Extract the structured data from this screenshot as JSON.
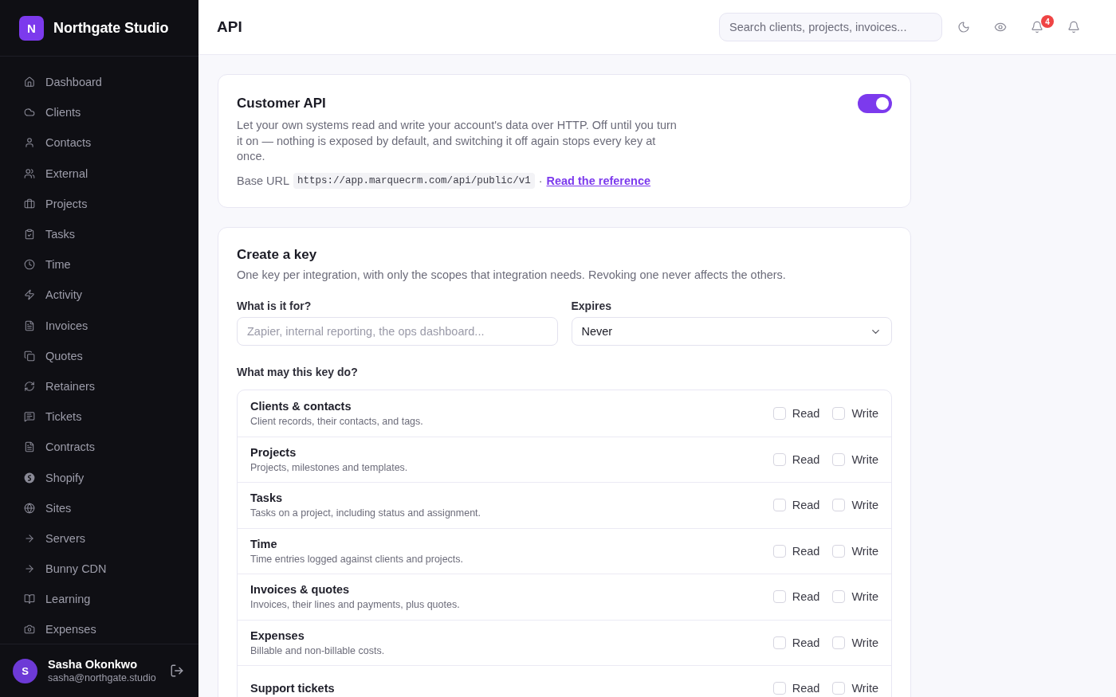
{
  "sidebar": {
    "brand": {
      "initial": "N",
      "name": "Northgate Studio"
    },
    "items": [
      {
        "label": "Dashboard",
        "selected": false
      },
      {
        "label": "Clients",
        "selected": false
      },
      {
        "label": "Contacts",
        "selected": false
      },
      {
        "label": "External",
        "selected": false
      },
      {
        "label": "Projects",
        "selected": false
      },
      {
        "label": "Tasks",
        "selected": false
      },
      {
        "label": "Time",
        "selected": false
      },
      {
        "label": "Activity",
        "selected": false
      },
      {
        "label": "Invoices",
        "selected": false
      },
      {
        "label": "Quotes",
        "selected": false
      },
      {
        "label": "Retainers",
        "selected": false
      },
      {
        "label": "Tickets",
        "selected": false
      },
      {
        "label": "Contracts",
        "selected": false
      },
      {
        "label": "Shopify",
        "selected": false
      },
      {
        "label": "Sites",
        "selected": false
      },
      {
        "label": "Servers",
        "selected": false
      },
      {
        "label": "Bunny CDN",
        "selected": false
      },
      {
        "label": "Learning",
        "selected": false
      },
      {
        "label": "Expenses",
        "selected": false
      }
    ],
    "user": {
      "initial": "S",
      "name": "Sasha Okonkwo",
      "email": "sasha@northgate.studio"
    }
  },
  "header": {
    "title": "API",
    "search": {
      "placeholder": "Search clients, projects, invoices..."
    },
    "notification_badge": "4"
  },
  "api_card": {
    "title": "Customer API",
    "enabled": true,
    "description": "Let your own systems read and write your account's data over HTTP. Off until you turn it on — nothing is exposed by default, and switching it off again stops every key at once.",
    "base_url_label": "Base URL",
    "base_url": "https://app.marquecrm.com/api/public/v1",
    "separator": "·",
    "link": "Read the reference"
  },
  "key_card": {
    "title": "Create a key",
    "description": "One key per integration, with only the scopes that integration needs. Revoking one never affects the others.",
    "purpose": {
      "label": "What is it for?",
      "placeholder": "Zapier, internal reporting, the ops dashboard..."
    },
    "expires": {
      "label": "Expires",
      "value": "Never"
    },
    "scopes_label": "What may this key do?",
    "scopes": [
      {
        "title": "Clients & contacts",
        "description": "Client records, their contacts, and tags.",
        "read": {
          "label": "Read",
          "checked": false
        },
        "write": {
          "label": "Write",
          "checked": false
        }
      },
      {
        "title": "Projects",
        "description": "Projects, milestones and templates.",
        "read": {
          "label": "Read",
          "checked": false
        },
        "write": {
          "label": "Write",
          "checked": false
        }
      },
      {
        "title": "Tasks",
        "description": "Tasks on a project, including status and assignment.",
        "read": {
          "label": "Read",
          "checked": false
        },
        "write": {
          "label": "Write",
          "checked": false
        }
      },
      {
        "title": "Time",
        "description": "Time entries logged against clients and projects.",
        "read": {
          "label": "Read",
          "checked": false
        },
        "write": {
          "label": "Write",
          "checked": false
        }
      },
      {
        "title": "Invoices & quotes",
        "description": "Invoices, their lines and payments, plus quotes.",
        "read": {
          "label": "Read",
          "checked": false
        },
        "write": {
          "label": "Write",
          "checked": false
        }
      },
      {
        "title": "Expenses",
        "description": "Billable and non-billable costs.",
        "read": {
          "label": "Read",
          "checked": false
        },
        "write": {
          "label": "Write",
          "checked": false
        }
      },
      {
        "title": "Support tickets",
        "read": {
          "label": "Read",
          "checked": false
        },
        "write": {
          "label": "Write",
          "checked": false
        }
      }
    ]
  }
}
